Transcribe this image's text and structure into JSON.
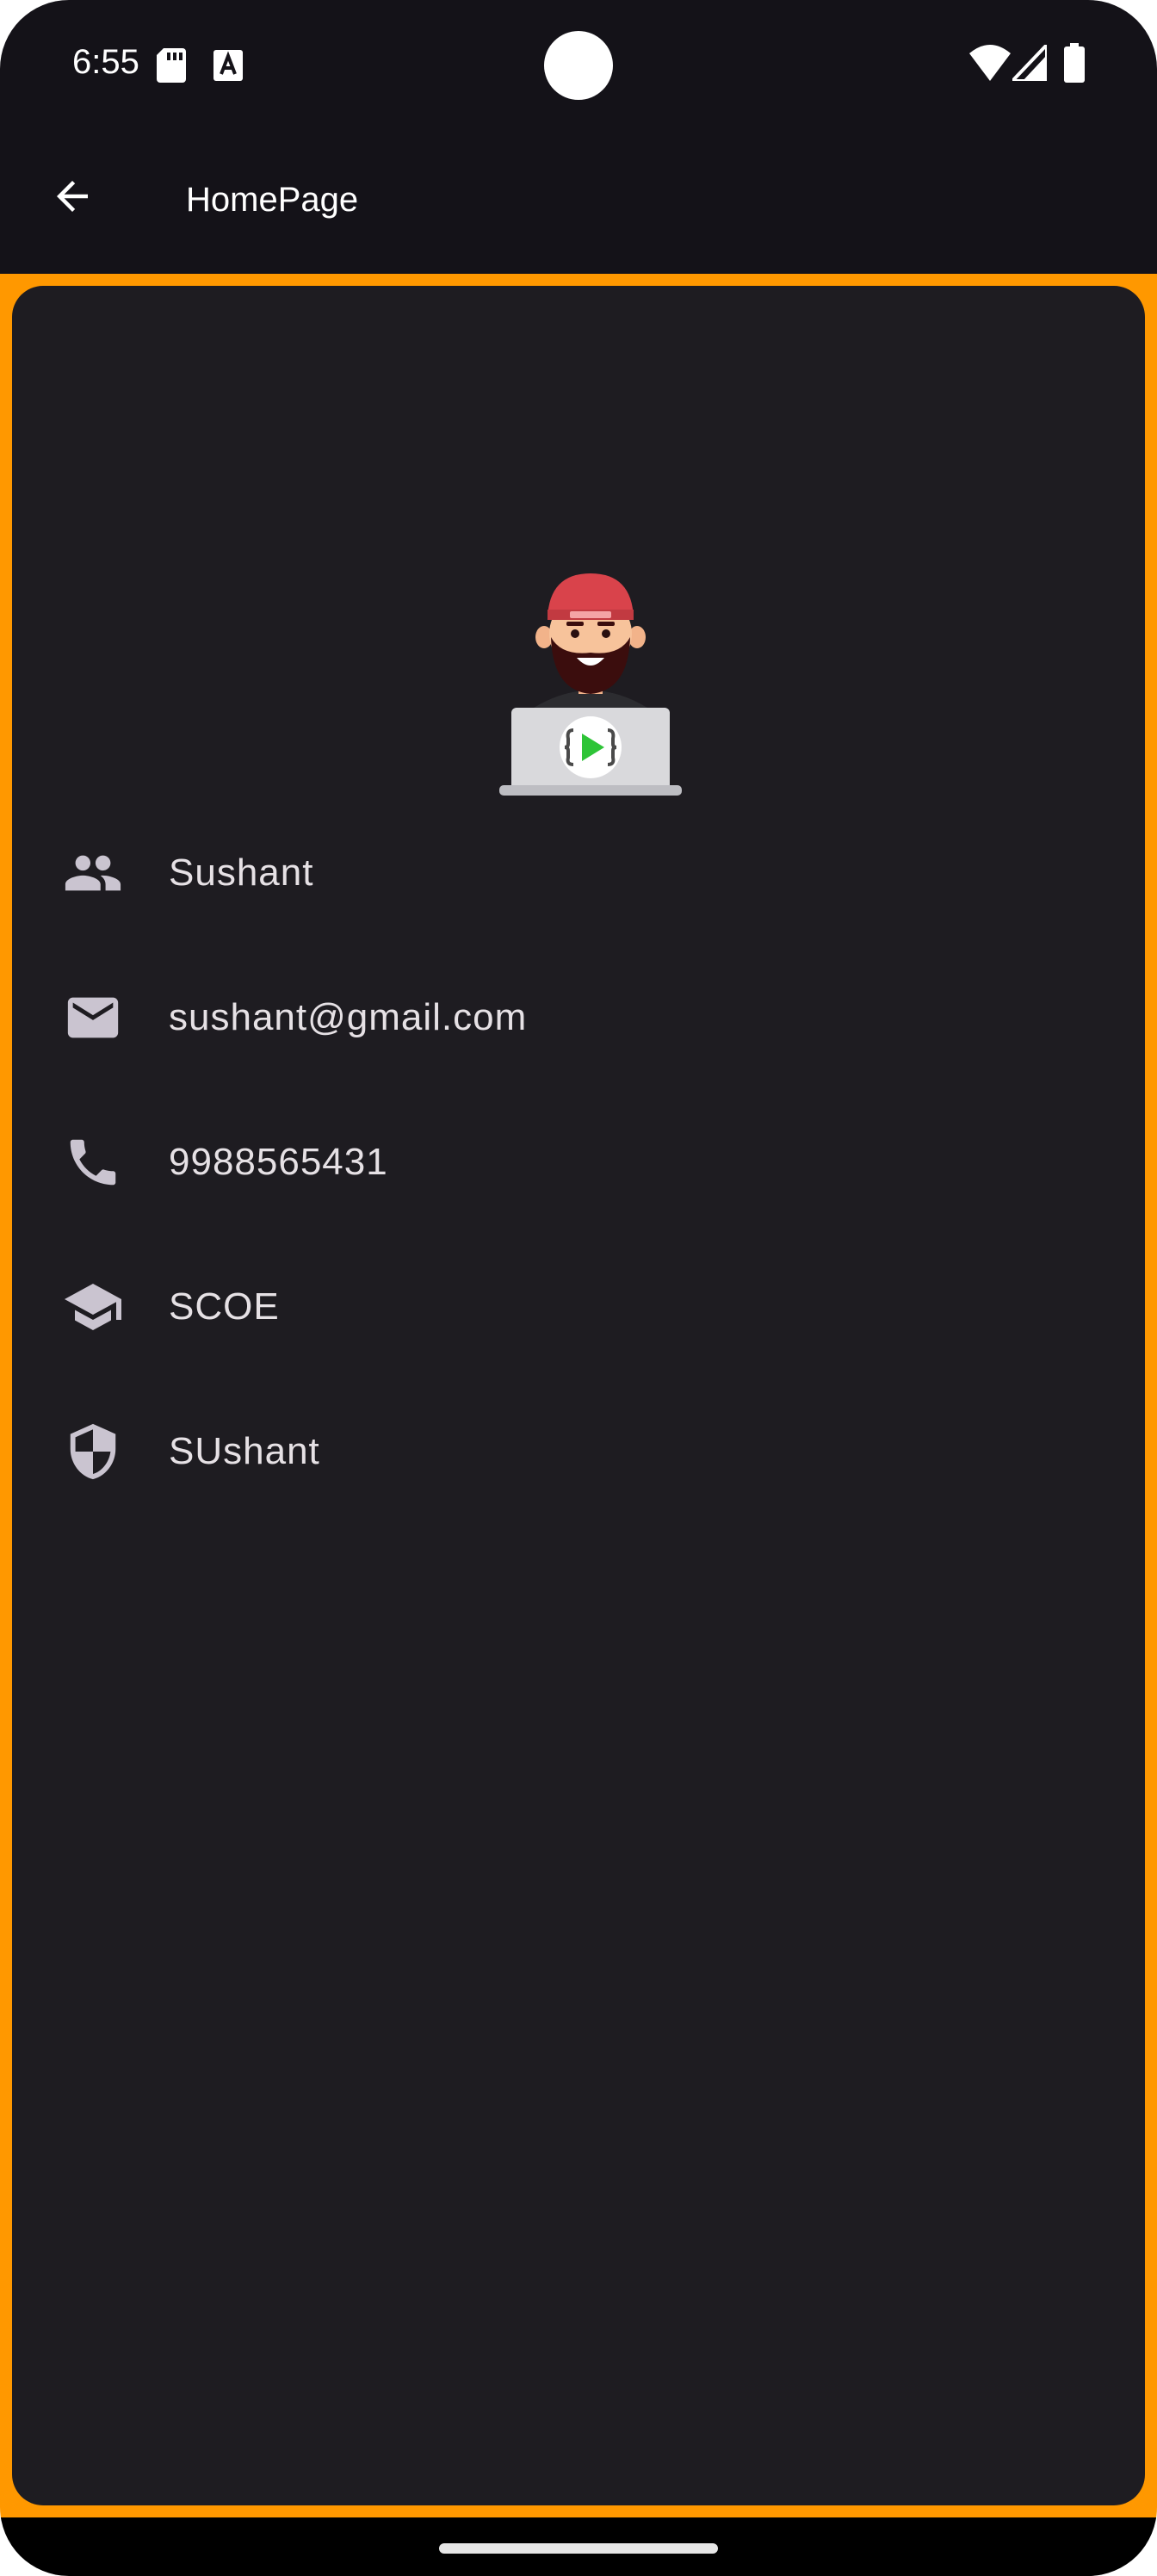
{
  "status_bar": {
    "time": "6:55",
    "left_icons": [
      "sd-card-icon",
      "font-a-icon"
    ],
    "right_icons": [
      "wifi-icon",
      "signal-icon",
      "battery-icon"
    ]
  },
  "app_bar": {
    "title": "HomePage",
    "back_icon": "arrow-back-icon"
  },
  "profile": {
    "avatar": "developer-avatar-icon",
    "rows": [
      {
        "icon": "people-icon",
        "value": "Sushant"
      },
      {
        "icon": "mail-icon",
        "value": "sushant@gmail.com"
      },
      {
        "icon": "phone-icon",
        "value": "9988565431"
      },
      {
        "icon": "school-icon",
        "value": "SCOE"
      },
      {
        "icon": "shield-icon",
        "value": "SUshant"
      }
    ]
  },
  "colors": {
    "frame_accent": "#ff9800",
    "card_background": "#1e1c21",
    "app_background": "#141218",
    "icon_color": "#cac4d0",
    "text_color": "#e6e1e5"
  }
}
